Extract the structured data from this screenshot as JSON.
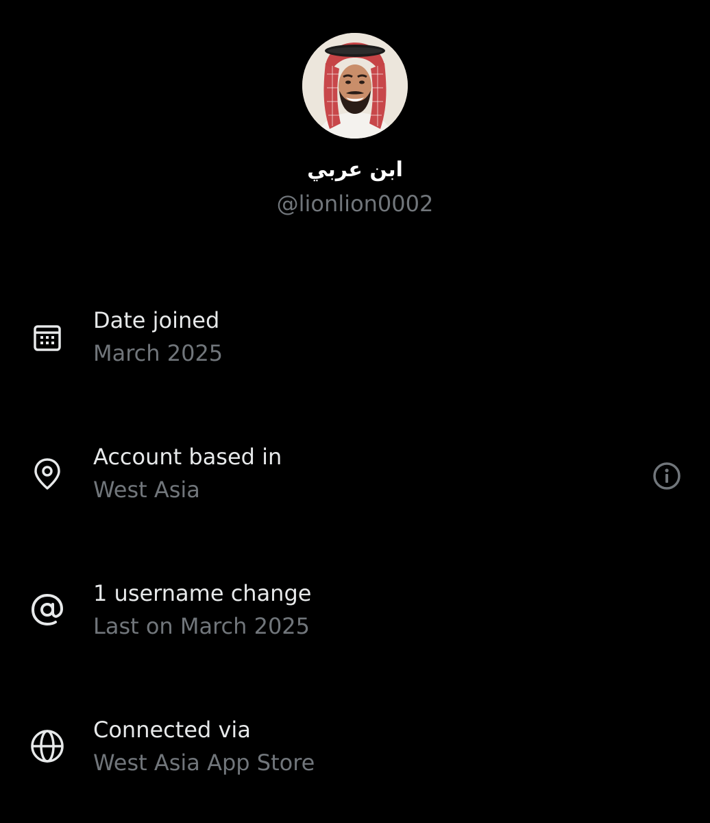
{
  "profile": {
    "display_name": "ابن عربي",
    "handle": "@lionlion0002"
  },
  "rows": [
    {
      "icon": "calendar-icon",
      "label": "Date joined",
      "value": "March 2025"
    },
    {
      "icon": "location-pin-icon",
      "label": "Account based in",
      "value": "West Asia",
      "has_info": true
    },
    {
      "icon": "at-sign-icon",
      "label": "1 username change",
      "value": "Last on March 2025"
    },
    {
      "icon": "globe-icon",
      "label": "Connected via",
      "value": "West Asia App Store"
    }
  ],
  "colors": {
    "background": "#000000",
    "primary_text": "#e7e9ea",
    "secondary_text": "#71767b",
    "icon": "#e7e9ea",
    "info_icon": "#71767b"
  }
}
